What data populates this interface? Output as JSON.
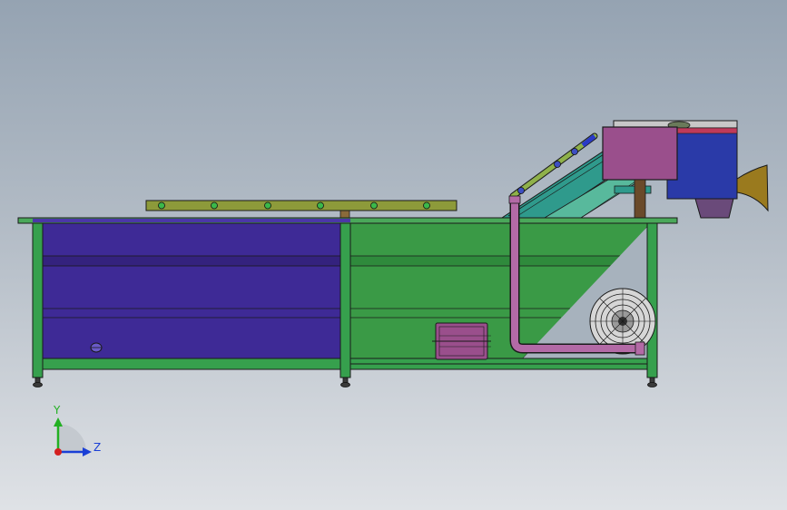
{
  "viewport": {
    "background_top": "#95a3b2",
    "background_bottom": "#dfe2e6"
  },
  "machine": {
    "frame_color": "#36a04d",
    "tank_left_color": "#3e2a96",
    "tank_right_color": "#3a9a46",
    "spray_pipe_color": "#8d9a3a",
    "air_pipe_color": "#b36aa6",
    "control_box_color": "#9a4f8c",
    "hopper_color": "#2a3aa8",
    "chute_color": "#9a7a1e",
    "blower_color": "#d6d6d6"
  },
  "triad": {
    "y_label": "Y",
    "z_label": "Z",
    "y_color": "#22b022",
    "z_color": "#1a3fd6",
    "origin_color": "#d42020"
  }
}
